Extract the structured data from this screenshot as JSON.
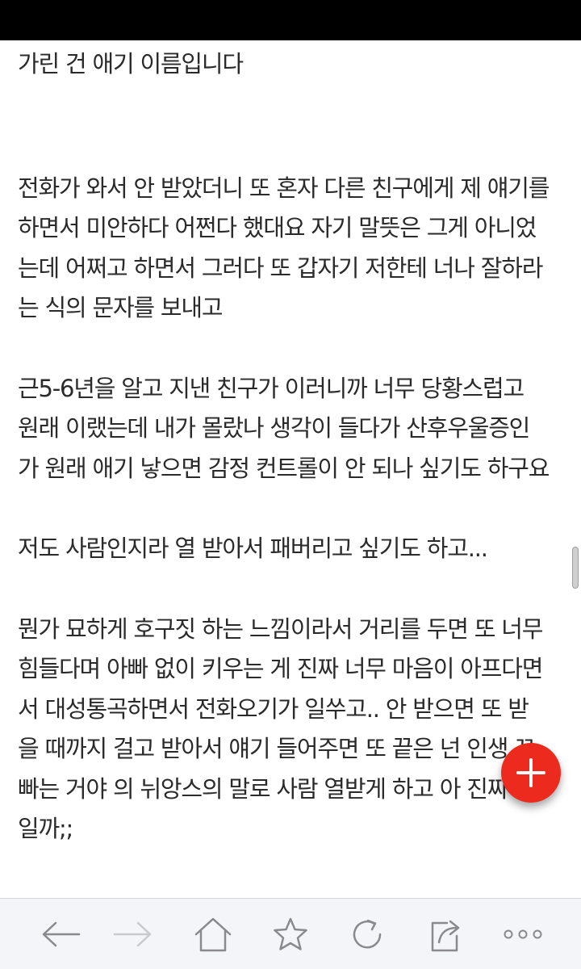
{
  "article": {
    "paragraphs": [
      {
        "lines": [
          "가린 건 애기 이름입니다"
        ]
      },
      {
        "lines": [
          "전화가 와서 안 받았더니 또 혼자 다른 친구에게 제 얘기를",
          "하면서 미안하다 어쩐다 했대요 자기 말뜻은 그게 아니었",
          "는데 어쩌고 하면서 그러다 또 갑자기 저한테 너나 잘하라",
          "는 식의 문자를 보내고"
        ]
      },
      {
        "lines": [
          "근5-6년을 알고 지낸 친구가 이러니까 너무 당황스럽고",
          "원래 이랬는데 내가 몰랐나 생각이 들다가 산후우울증인",
          "가 원래 애기 낳으면 감정 컨트롤이 안 되나 싶기도 하구요"
        ]
      },
      {
        "lines": [
          "저도 사람인지라 열 받아서 패버리고 싶기도 하고..."
        ]
      },
      {
        "lines": [
          "뭔가 묘하게 호구짓 하는 느낌이라서 거리를 두면 또 너무",
          "힘들다며 아빠 없이 키우는 게 진짜 너무 마음이 아프다면",
          "서 대성통곡하면서 전화오기가 일쑤고.. 안 받으면 또 받",
          "을 때까지 걸고 받아서 얘기 들어주면 또 끝은 넌 인생 꼬",
          "빠는 거야 의 뉘앙스의 말로 사람 열받게 하고 아 진짜 뭔",
          "일까;;"
        ]
      }
    ]
  },
  "fab": {
    "icon": "plus-icon",
    "color": "#ec2a1d"
  },
  "toolbar": {
    "icons": [
      "back-arrow-icon",
      "forward-arrow-icon",
      "home-icon",
      "star-icon",
      "refresh-icon",
      "share-icon",
      "more-icon"
    ],
    "background": "#f4f5f9"
  }
}
